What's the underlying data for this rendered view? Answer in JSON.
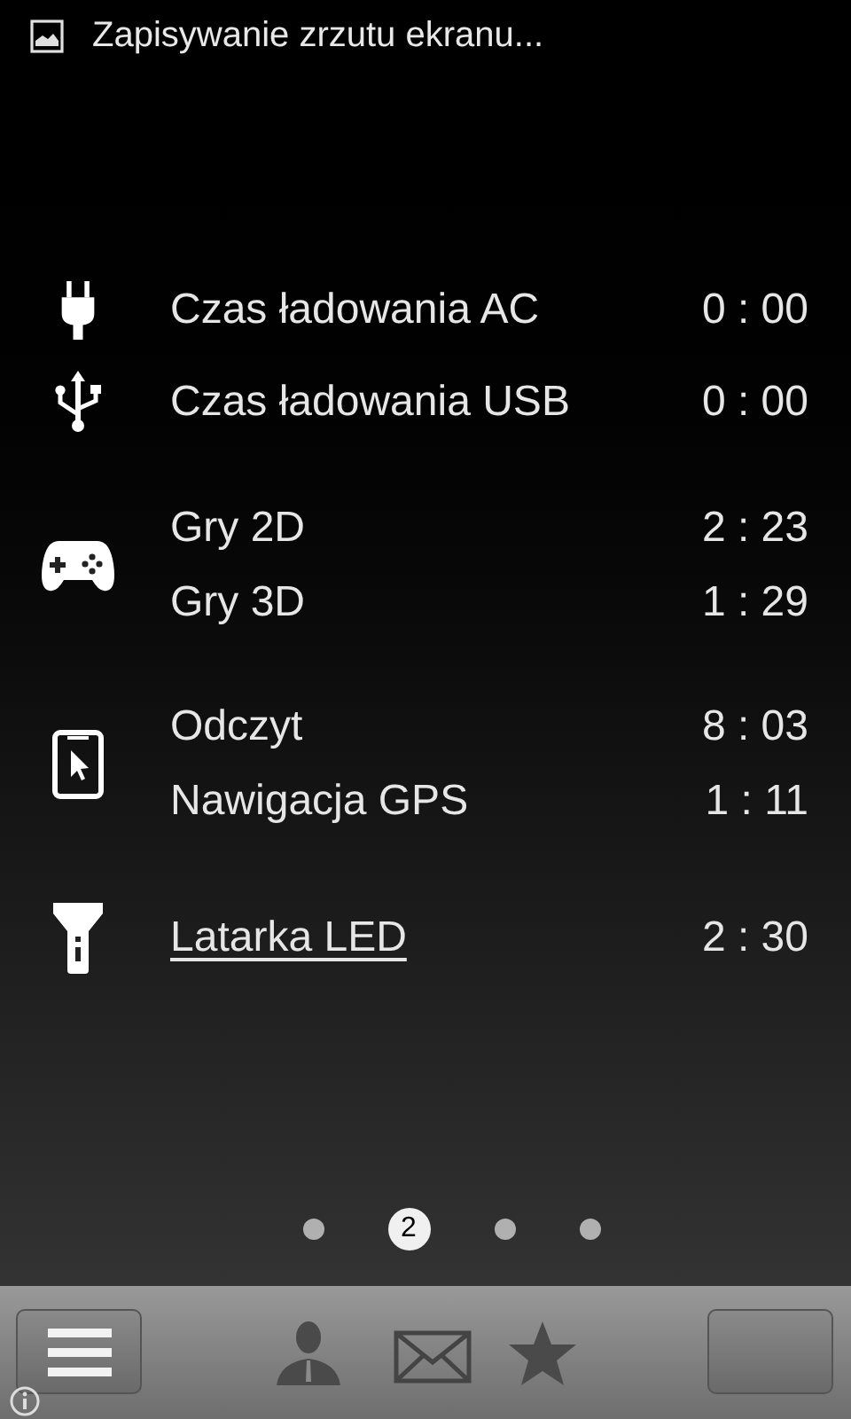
{
  "notification": {
    "text": "Zapisywanie zrzutu ekranu..."
  },
  "groups": [
    {
      "kind": "plug",
      "rows": [
        {
          "label": "Czas ładowania AC",
          "time": "0 : 00",
          "underlined": false
        }
      ]
    },
    {
      "kind": "usb",
      "rows": [
        {
          "label": "Czas ładowania USB",
          "time": "0 : 00",
          "underlined": false
        }
      ]
    },
    {
      "kind": "gamepad",
      "rows": [
        {
          "label": "Gry 2D",
          "time": "2 : 23",
          "underlined": false
        },
        {
          "label": "Gry 3D",
          "time": "1 : 29",
          "underlined": false
        }
      ]
    },
    {
      "kind": "tablet",
      "rows": [
        {
          "label": "Odczyt",
          "time": "8 : 03",
          "underlined": false
        },
        {
          "label": "Nawigacja GPS",
          "time": "1 : 11",
          "underlined": false
        }
      ]
    },
    {
      "kind": "flashlight",
      "rows": [
        {
          "label": "Latarka LED",
          "time": "2 : 30",
          "underlined": true
        }
      ]
    }
  ],
  "pages": [
    {
      "selected": false
    },
    {
      "selected": true,
      "label": "2"
    },
    {
      "selected": false
    },
    {
      "selected": false
    }
  ]
}
